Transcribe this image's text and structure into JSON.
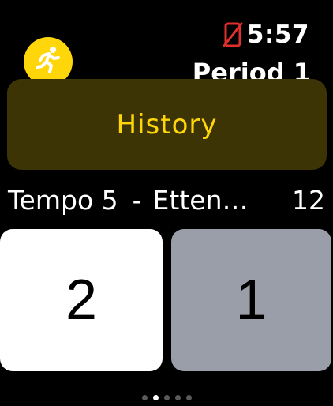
{
  "colors": {
    "accent": "#ffd60a",
    "history_bg": "#3c3404",
    "history_text": "#ffd60a",
    "home_card": "#ffffff",
    "away_card": "#9a9ea8",
    "alert_red": "#e0302c"
  },
  "status": {
    "time": "5:57",
    "phone_icon": "phone-disconnected-icon"
  },
  "workout": {
    "icon": "running-figure-icon"
  },
  "period": {
    "label": "Period 1"
  },
  "history": {
    "label": "History"
  },
  "match": {
    "home_team": "Tempo 5",
    "separator": "-",
    "away_team": "Etten…",
    "minute": "12"
  },
  "score": {
    "home": "2",
    "away": "1"
  },
  "pagination": {
    "total": 5,
    "active_index": 1
  }
}
